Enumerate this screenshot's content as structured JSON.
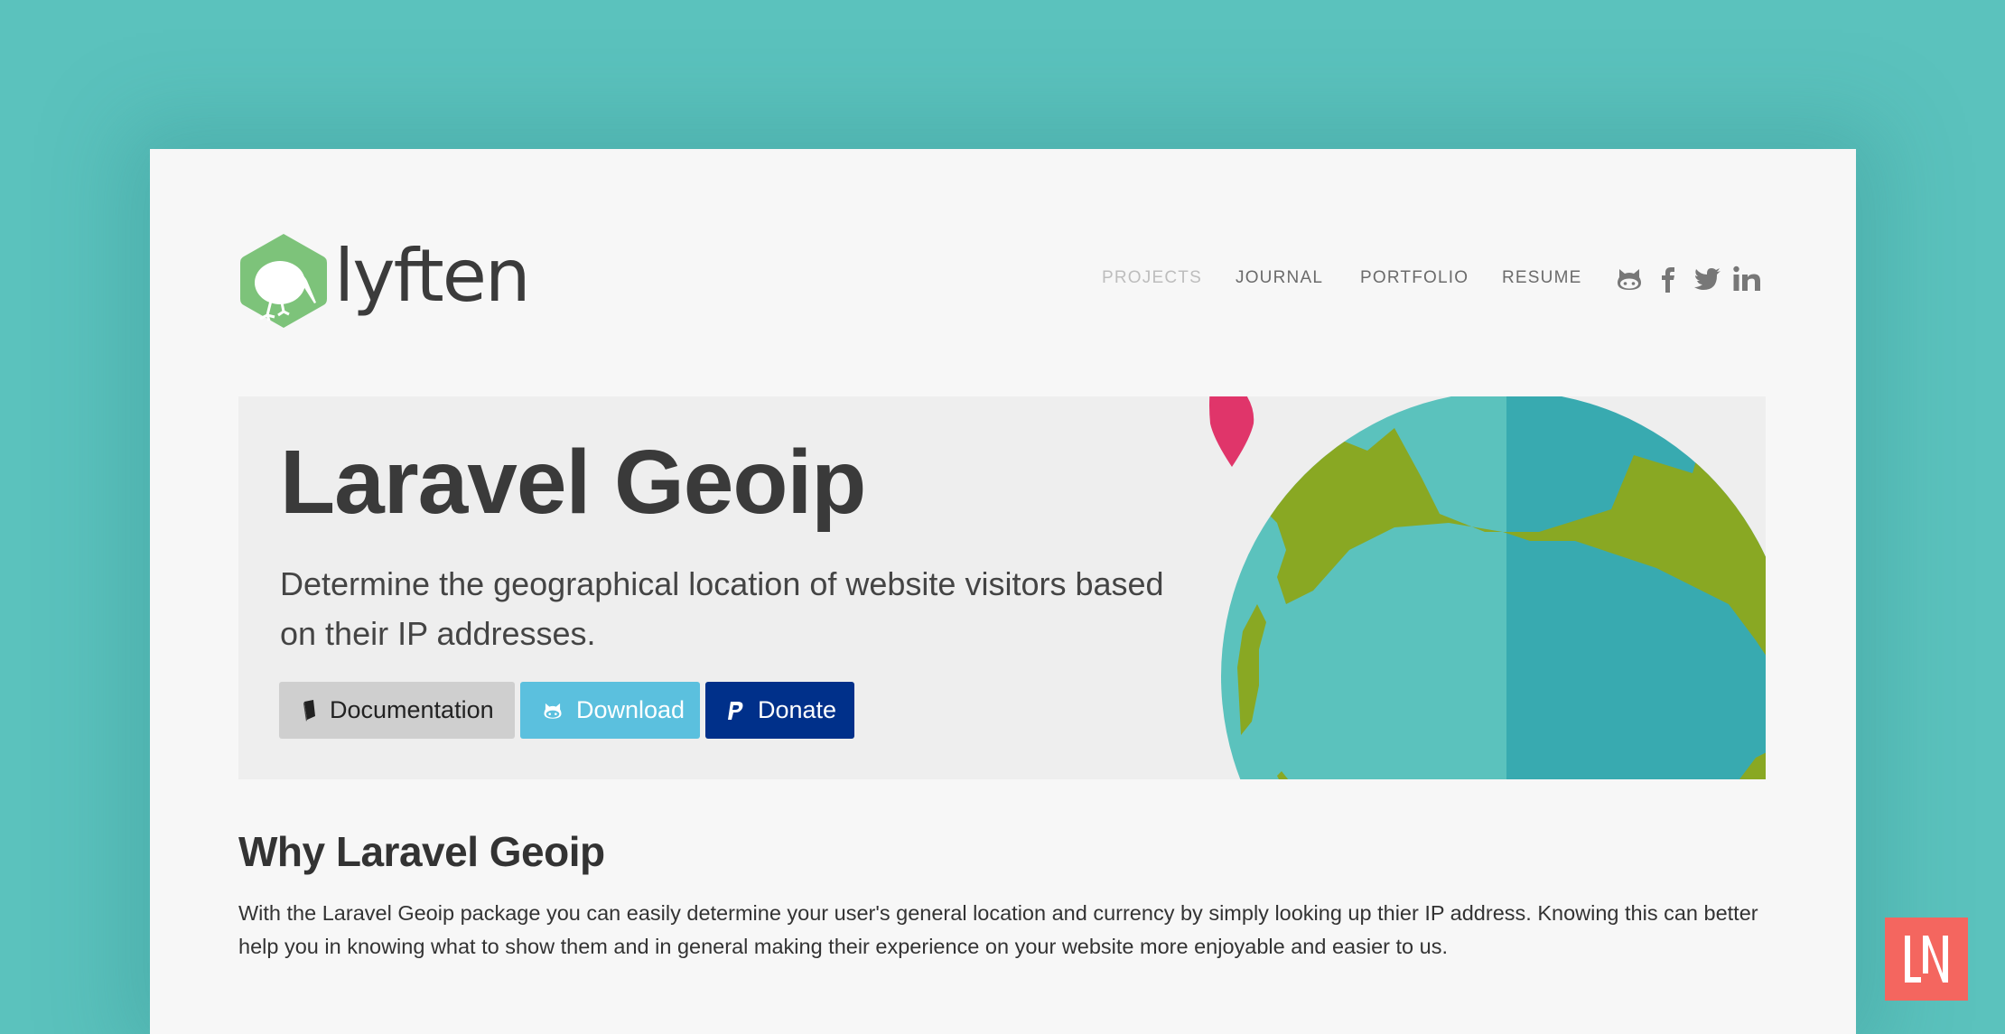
{
  "brand": {
    "name": "lyften",
    "logo_color": "#7dc37a"
  },
  "nav": {
    "items": [
      {
        "label": "PROJECTS",
        "active": true
      },
      {
        "label": "JOURNAL",
        "active": false
      },
      {
        "label": "PORTFOLIO",
        "active": false
      },
      {
        "label": "RESUME",
        "active": false
      }
    ],
    "social_icons": [
      "github-icon",
      "facebook-icon",
      "twitter-icon",
      "linkedin-icon"
    ]
  },
  "hero": {
    "title": "Laravel Geoip",
    "subtitle": "Determine the geographical location of website visitors based on their IP addresses.",
    "buttons": [
      {
        "label": "Documentation",
        "icon": "book-icon",
        "color": "#cfcfcf"
      },
      {
        "label": "Download",
        "icon": "github-icon",
        "color": "#5bc0de"
      },
      {
        "label": "Donate",
        "icon": "paypal-icon",
        "color": "#00308a"
      }
    ],
    "illustration": "globe-with-map-pin"
  },
  "section": {
    "title": "Why Laravel Geoip",
    "body": "With the Laravel Geoip package you can easily determine your user's general location and currency by simply looking up thier IP address. Knowing this can better help you in knowing what to show them and in general making their experience on your website more enjoyable and easier to us."
  },
  "badge": {
    "text": "LN",
    "color": "#f4665f"
  },
  "colors": {
    "background": "#5bc2bd",
    "card": "#f7f7f7",
    "hero": "#eeeeee",
    "globe_water_light": "#5bc2bd",
    "globe_water_dark": "#38aab0",
    "globe_land": "#89a823",
    "pin": "#e0356a"
  }
}
